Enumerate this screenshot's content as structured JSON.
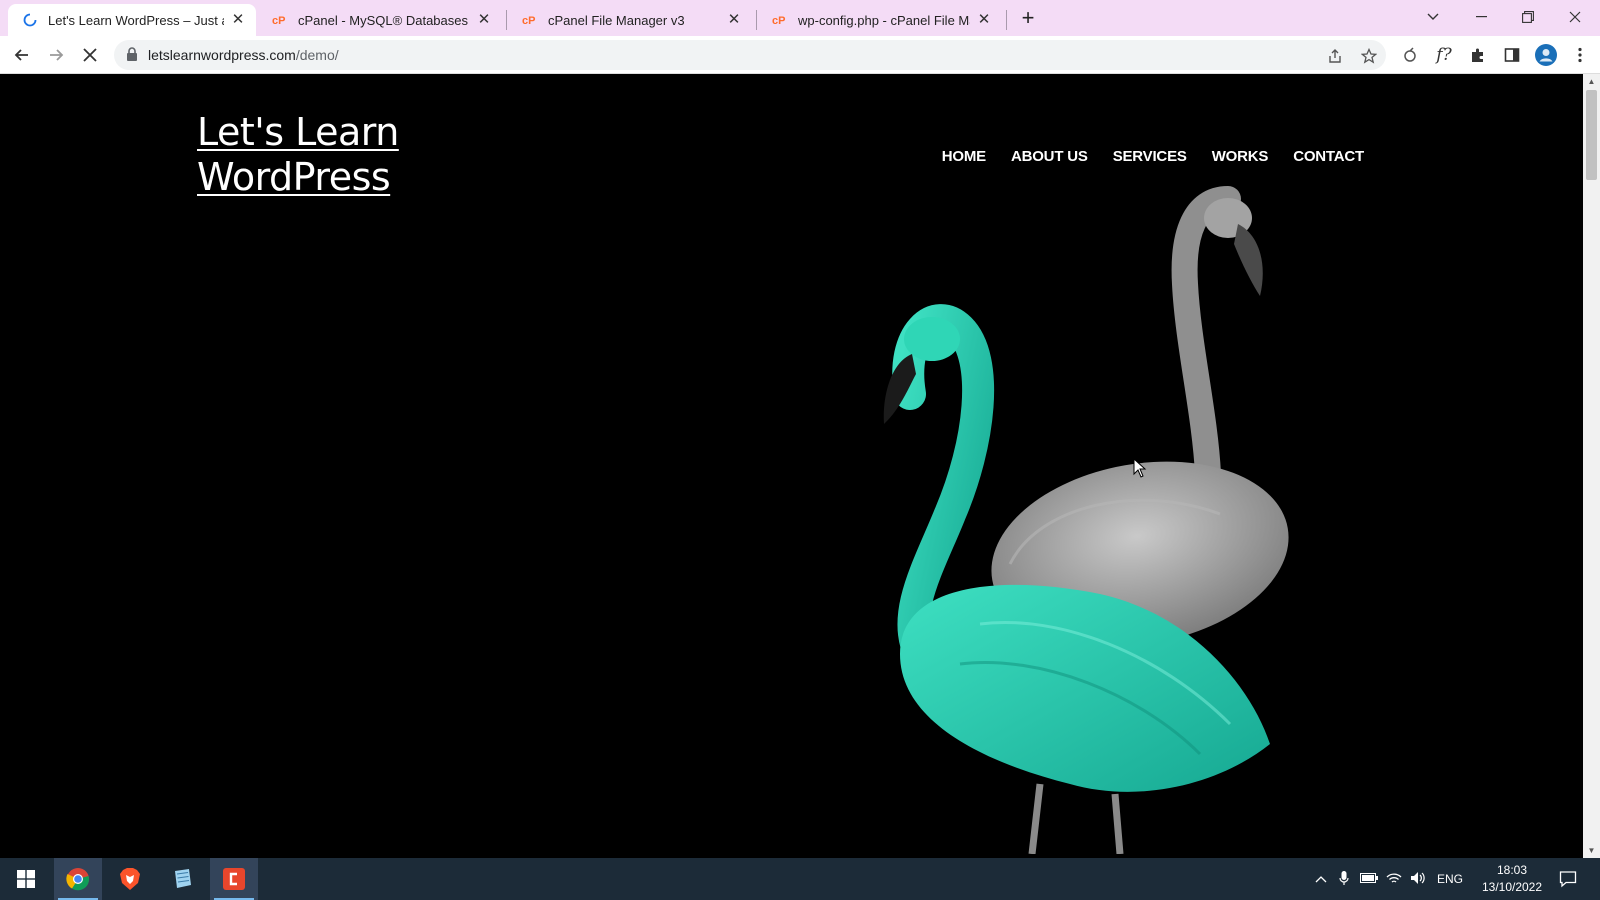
{
  "browser": {
    "tabs": [
      {
        "title": "Let's Learn WordPress – Just ano",
        "icon": "loading-spinner-icon",
        "active": true
      },
      {
        "title": "cPanel - MySQL® Databases",
        "icon": "cpanel-icon",
        "active": false
      },
      {
        "title": "cPanel File Manager v3",
        "icon": "cpanel-icon",
        "active": false
      },
      {
        "title": "wp-config.php - cPanel File Mana",
        "icon": "cpanel-icon",
        "active": false
      }
    ],
    "new_tab": "+",
    "url_host": "letslearnwordpress.com",
    "url_path": "/demo/"
  },
  "site": {
    "title_line1": "Let's Learn",
    "title_line2": "WordPress",
    "nav": [
      "HOME",
      "ABOUT US",
      "SERVICES",
      "WORKS",
      "CONTACT"
    ]
  },
  "taskbar": {
    "language": "ENG",
    "time": "18:03",
    "date": "13/10/2022"
  },
  "colors": {
    "tabbar": "#f4dcf6",
    "page_bg": "#000000",
    "flamingo_teal": "#22c6ac",
    "flamingo_grey": "#9a9a9a",
    "taskbar": "#1c2b38"
  }
}
